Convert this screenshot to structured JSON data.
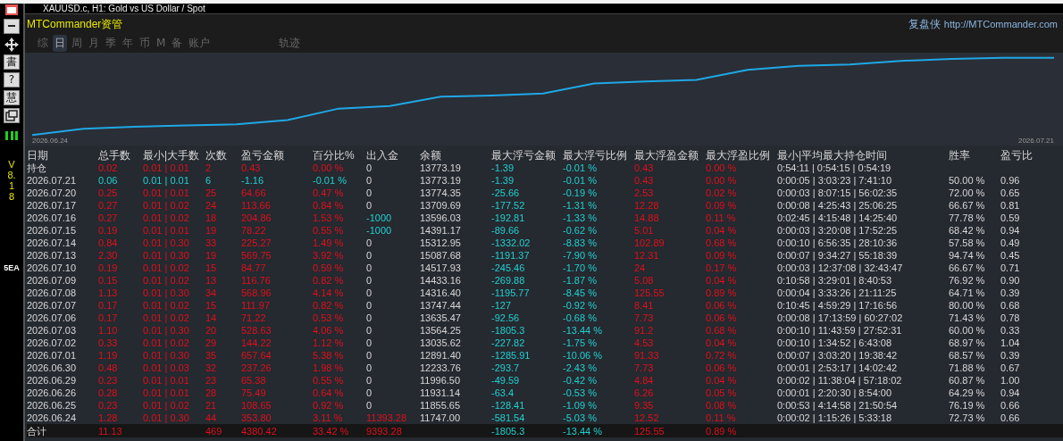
{
  "window_title": "XAUUSD.c, H1:  Gold vs US Dollar / Spot",
  "toolbar": [
    {
      "kind": "minus"
    },
    {
      "kind": "move"
    },
    {
      "kind": "glyph",
      "label": "書"
    },
    {
      "kind": "glyph",
      "label": "?"
    },
    {
      "kind": "glyph",
      "label": "慧"
    },
    {
      "kind": "window"
    }
  ],
  "side": {
    "version": "V8.18",
    "label": "5EA"
  },
  "panel": {
    "brand": "MTCommander资管",
    "site_name": "复盘侠",
    "site_url": "http://MTCommander.com"
  },
  "tabs": [
    {
      "label": "综",
      "selected": false
    },
    {
      "label": "日",
      "selected": true
    },
    {
      "label": "周",
      "selected": false
    },
    {
      "label": "月",
      "selected": false
    },
    {
      "label": "季",
      "selected": false
    },
    {
      "label": "年",
      "selected": false
    },
    {
      "label": "币",
      "selected": false
    },
    {
      "label": "M",
      "selected": false
    },
    {
      "label": "备",
      "selected": false
    },
    {
      "label": "账户",
      "selected": false
    },
    {
      "label": "轨迹",
      "selected": false
    }
  ],
  "chart": {
    "start_label": "2026.06.24",
    "end_label": "2026.07.21"
  },
  "table": {
    "columns": [
      "日期",
      "总手数",
      "最小|大手数",
      "次数",
      "盈亏金额",
      "百分比%",
      "出入金",
      "余额",
      "最大浮亏金额",
      "最大浮亏比例",
      "最大浮盈金额",
      "最大浮盈比例",
      "最小|平均最大持仓时间",
      "胜率",
      "盈亏比"
    ],
    "rows": [
      {
        "profit": true,
        "deposit": false,
        "withdrawal": false,
        "cells": [
          "持仓",
          "0.02",
          "0.01 | 0.01",
          "2",
          "0.43",
          "0.00 %",
          "0",
          "13773.19",
          "-1.39",
          "-0.01 %",
          "0.43",
          "0.00 %",
          "0:54:11 | 0:54:15 | 0:54:19",
          null,
          null
        ]
      },
      {
        "profit": false,
        "deposit": false,
        "withdrawal": false,
        "cells": [
          "2026.07.21",
          "0.06",
          "0.01 | 0.01",
          "6",
          "-1.16",
          "-0.01 %",
          "0",
          "13773.19",
          "-1.39",
          "-0.01 %",
          "0.43",
          "0.00 %",
          "0:00:05 | 3:03:23 | 7:41:10",
          "50.00 %",
          "0.96"
        ]
      },
      {
        "profit": true,
        "deposit": false,
        "withdrawal": false,
        "cells": [
          "2026.07.20",
          "0.25",
          "0.01 | 0.01",
          "25",
          "64.66",
          "0.47 %",
          "0",
          "13774.35",
          "-25.66",
          "-0.19 %",
          "2.53",
          "0.02 %",
          "0:00:03 | 8:07:15 | 56:02:35",
          "72.00 %",
          "0.65"
        ]
      },
      {
        "profit": true,
        "deposit": false,
        "withdrawal": false,
        "cells": [
          "2026.07.17",
          "0.27",
          "0.01 | 0.02",
          "24",
          "113.66",
          "0.84 %",
          "0",
          "13709.69",
          "-177.52",
          "-1.31 %",
          "12.28",
          "0.09 %",
          "0:00:08 | 4:25:43 | 25:06:25",
          "66.67 %",
          "0.81"
        ]
      },
      {
        "profit": true,
        "deposit": false,
        "withdrawal": true,
        "cells": [
          "2026.07.16",
          "0.27",
          "0.01 | 0.02",
          "18",
          "204.86",
          "1.53 %",
          "-1000",
          "13596.03",
          "-192.81",
          "-1.33 %",
          "14.88",
          "0.11 %",
          "0:02:45 | 4:15:48 | 14:25:40",
          "77.78 %",
          "0.59"
        ]
      },
      {
        "profit": true,
        "deposit": false,
        "withdrawal": true,
        "cells": [
          "2026.07.15",
          "0.19",
          "0.01 | 0.01",
          "19",
          "78.22",
          "0.55 %",
          "-1000",
          "14391.17",
          "-89.66",
          "-0.62 %",
          "5.01",
          "0.04 %",
          "0:00:03 | 3:20:08 | 17:52:25",
          "68.42 %",
          "0.94"
        ]
      },
      {
        "profit": true,
        "deposit": false,
        "withdrawal": false,
        "cells": [
          "2026.07.14",
          "0.84",
          "0.01 | 0.30",
          "33",
          "225.27",
          "1.49 %",
          "0",
          "15312.95",
          "-1332.02",
          "-8.83 %",
          "102.89",
          "0.68 %",
          "0:00:10 | 6:56:35 | 28:10:36",
          "57.58 %",
          "0.49"
        ]
      },
      {
        "profit": true,
        "deposit": false,
        "withdrawal": false,
        "cells": [
          "2026.07.13",
          "2.30",
          "0.01 | 0.30",
          "19",
          "569.75",
          "3.92 %",
          "0",
          "15087.68",
          "-1191.37",
          "-7.90 %",
          "12.31",
          "0.09 %",
          "0:00:07 | 9:34:27 | 55:18:39",
          "94.74 %",
          "0.45"
        ]
      },
      {
        "profit": true,
        "deposit": false,
        "withdrawal": false,
        "cells": [
          "2026.07.10",
          "0.19",
          "0.01 | 0.02",
          "15",
          "84.77",
          "0.59 %",
          "0",
          "14517.93",
          "-245.46",
          "-1.70 %",
          "24",
          "0.17 %",
          "0:00:03 | 12:37:08 | 32:43:47",
          "66.67 %",
          "0.71"
        ]
      },
      {
        "profit": true,
        "deposit": false,
        "withdrawal": false,
        "cells": [
          "2026.07.09",
          "0.15",
          "0.01 | 0.02",
          "13",
          "116.76",
          "0.82 %",
          "0",
          "14433.16",
          "-269.88",
          "-1.87 %",
          "5.08",
          "0.04 %",
          "0:10:58 | 3:29:01 | 8:40:53",
          "76.92 %",
          "0.90"
        ]
      },
      {
        "profit": true,
        "deposit": false,
        "withdrawal": false,
        "cells": [
          "2026.07.08",
          "1.13",
          "0.01 | 0.30",
          "34",
          "568.96",
          "4.14 %",
          "0",
          "14316.40",
          "-1195.77",
          "-8.45 %",
          "125.55",
          "0.89 %",
          "0:00:04 | 3:33:26 | 21:11:25",
          "64.71 %",
          "0.39"
        ]
      },
      {
        "profit": true,
        "deposit": false,
        "withdrawal": false,
        "cells": [
          "2026.07.07",
          "0.17",
          "0.01 | 0.02",
          "15",
          "111.97",
          "0.82 %",
          "0",
          "13747.44",
          "-127",
          "-0.92 %",
          "8.41",
          "0.06 %",
          "0:10:45 | 4:59:29 | 17:16:56",
          "80.00 %",
          "0.68"
        ]
      },
      {
        "profit": true,
        "deposit": false,
        "withdrawal": false,
        "cells": [
          "2026.07.06",
          "0.17",
          "0.01 | 0.02",
          "14",
          "71.22",
          "0.53 %",
          "0",
          "13635.47",
          "-92.56",
          "-0.68 %",
          "7.73",
          "0.06 %",
          "0:00:08 | 17:13:59 | 60:27:02",
          "71.43 %",
          "0.78"
        ]
      },
      {
        "profit": true,
        "deposit": false,
        "withdrawal": false,
        "cells": [
          "2026.07.03",
          "1.10",
          "0.01 | 0.30",
          "20",
          "528.63",
          "4.06 %",
          "0",
          "13564.25",
          "-1805.3",
          "-13.44 %",
          "91.2",
          "0.68 %",
          "0:00:10 | 11:43:59 | 27:52:31",
          "60.00 %",
          "0.33"
        ]
      },
      {
        "profit": true,
        "deposit": false,
        "withdrawal": false,
        "cells": [
          "2026.07.02",
          "0.33",
          "0.01 | 0.02",
          "29",
          "144.22",
          "1.12 %",
          "0",
          "13035.62",
          "-227.82",
          "-1.75 %",
          "4.53",
          "0.04 %",
          "0:00:10 | 1:34:52 | 6:43:08",
          "68.97 %",
          "1.04"
        ]
      },
      {
        "profit": true,
        "deposit": false,
        "withdrawal": false,
        "cells": [
          "2026.07.01",
          "1.19",
          "0.01 | 0.30",
          "35",
          "657.64",
          "5.38 %",
          "0",
          "12891.40",
          "-1285.91",
          "-10.06 %",
          "91.33",
          "0.72 %",
          "0:00:07 | 3:03:20 | 19:38:42",
          "68.57 %",
          "0.39"
        ]
      },
      {
        "profit": true,
        "deposit": false,
        "withdrawal": false,
        "cells": [
          "2026.06.30",
          "0.48",
          "0.01 | 0.03",
          "32",
          "237.26",
          "1.98 %",
          "0",
          "12233.76",
          "-293.7",
          "-2.43 %",
          "7.73",
          "0.06 %",
          "0:00:01 | 2:53:17 | 14:02:42",
          "71.88 %",
          "0.67"
        ]
      },
      {
        "profit": true,
        "deposit": false,
        "withdrawal": false,
        "cells": [
          "2026.06.29",
          "0.23",
          "0.01 | 0.01",
          "23",
          "65.38",
          "0.55 %",
          "0",
          "11996.50",
          "-49.59",
          "-0.42 %",
          "4.84",
          "0.04 %",
          "0:00:02 | 11:38:04 | 57:18:02",
          "60.87 %",
          "1.00"
        ]
      },
      {
        "profit": true,
        "deposit": false,
        "withdrawal": false,
        "cells": [
          "2026.06.26",
          "0.28",
          "0.01 | 0.01",
          "28",
          "75.49",
          "0.64 %",
          "0",
          "11931.14",
          "-63.4",
          "-0.53 %",
          "6.26",
          "0.05 %",
          "0:00:01 | 2:20:30 | 8:54:00",
          "64.29 %",
          "0.94"
        ]
      },
      {
        "profit": true,
        "deposit": false,
        "withdrawal": false,
        "cells": [
          "2026.06.25",
          "0.23",
          "0.01 | 0.02",
          "21",
          "108.65",
          "0.92 %",
          "0",
          "11855.65",
          "-128.41",
          "-1.09 %",
          "9.35",
          "0.08 %",
          "0:00:53 | 4:14:58 | 21:50:54",
          "76.19 %",
          "0.66"
        ]
      },
      {
        "profit": true,
        "deposit": true,
        "withdrawal": false,
        "cells": [
          "2026.06.24",
          "1.28",
          "0.01 | 0.30",
          "44",
          "353.80",
          "3.11 %",
          "11393.28",
          "11747.00",
          "-581.54",
          "-5.03 %",
          "12.52",
          "0.11 %",
          "0:00:02 | 1:15:26 | 5:33:18",
          "72.73 %",
          "0.66"
        ]
      }
    ],
    "total": {
      "profit": true,
      "deposit": true,
      "withdrawal": false,
      "cells": [
        "合计",
        "11.13",
        null,
        "469",
        "4380.42",
        "33.42 %",
        "9393.28",
        null,
        "-1805.3",
        "-13.44 %",
        "125.55",
        "0.89 %",
        null,
        null,
        null
      ]
    }
  }
}
